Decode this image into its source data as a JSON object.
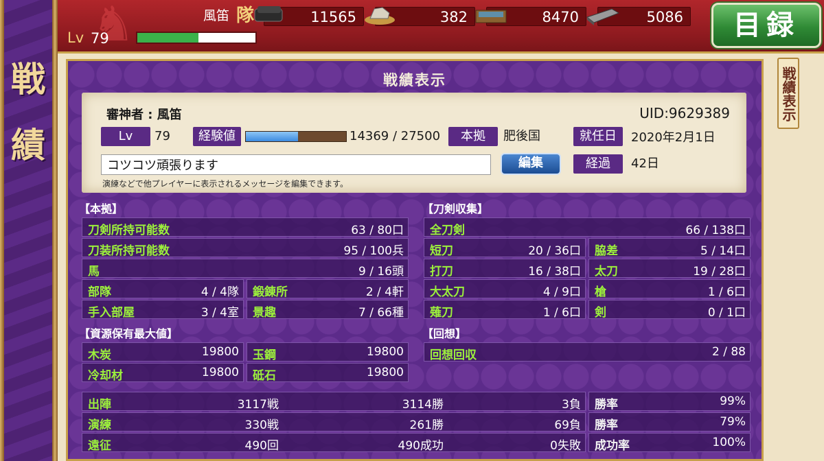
{
  "header": {
    "player_name": "風笛",
    "butai_label": "隊",
    "level_label": "Lv",
    "level_value": "79",
    "level_progress": 0.52,
    "resources": [
      {
        "icon": "charcoal-icon",
        "value": "11565"
      },
      {
        "icon": "tamahagane-icon",
        "value": "382"
      },
      {
        "icon": "coolant-icon",
        "value": "8470"
      },
      {
        "icon": "whetstone-icon",
        "value": "5086"
      }
    ],
    "menu_button": "目録"
  },
  "left_panel": {
    "title": "戦績"
  },
  "side_tab": {
    "label": "戦績表示"
  },
  "panel": {
    "title": "戦績表示",
    "profile": {
      "name": "審神者 : 風笛",
      "uid": "UID:9629389",
      "lv_label": "Lv",
      "lv_value": "79",
      "exp_label": "経験値",
      "exp_text": "14369 / 27500",
      "exp_progress": 0.5225,
      "home_label": "本拠",
      "home_value": "肥後国",
      "appoint_label": "就任日",
      "appoint_value": "2020年2月1日",
      "elapsed_label": "経過",
      "elapsed_value": "42日",
      "message": "コツコツ頑張ります",
      "edit_button": "編集",
      "hint": "演練などで他プレイヤーに表示されるメッセージを編集できます。"
    },
    "honkyo": {
      "head": "【本拠】",
      "rows": [
        {
          "label": "刀剣所持可能数",
          "value": "63 / 80口"
        },
        {
          "label": "刀装所持可能数",
          "value": "95 / 100兵"
        },
        {
          "label": "馬",
          "value": "9 / 16頭"
        }
      ],
      "pairs": [
        {
          "label": "部隊",
          "value": "4 / 4隊"
        },
        {
          "label": "鍛錬所",
          "value": "2 / 4軒"
        },
        {
          "label": "手入部屋",
          "value": "3 / 4室"
        },
        {
          "label": "景趣",
          "value": "7 / 66種"
        }
      ]
    },
    "resources_max": {
      "head": "【資源保有最大値】",
      "items": [
        {
          "label": "木炭",
          "value": "19800"
        },
        {
          "label": "玉鋼",
          "value": "19800"
        },
        {
          "label": "冷却材",
          "value": "19800"
        },
        {
          "label": "砥石",
          "value": "19800"
        }
      ]
    },
    "touken": {
      "head": "【刀剣収集】",
      "all": {
        "label": "全刀剣",
        "value": "66 / 138口"
      },
      "items": [
        {
          "label": "短刀",
          "value": "20 / 36口"
        },
        {
          "label": "脇差",
          "value": "5 / 14口"
        },
        {
          "label": "打刀",
          "value": "16 / 38口"
        },
        {
          "label": "太刀",
          "value": "19 / 28口"
        },
        {
          "label": "大太刀",
          "value": "4 / 9口"
        },
        {
          "label": "槍",
          "value": "1 / 6口"
        },
        {
          "label": "薙刀",
          "value": "1 / 6口"
        },
        {
          "label": "剣",
          "value": "0 / 1口"
        }
      ]
    },
    "kaisou": {
      "head": "【回想】",
      "row": {
        "label": "回想回収",
        "value": "2 / 88"
      }
    },
    "battle": [
      {
        "label": "出陣",
        "c1": "3117戦",
        "c2": "3114勝",
        "c3": "3負",
        "rate_label": "勝率",
        "rate": "99%"
      },
      {
        "label": "演練",
        "c1": "330戦",
        "c2": "261勝",
        "c3": "69負",
        "rate_label": "勝率",
        "rate": "79%"
      },
      {
        "label": "遠征",
        "c1": "490回",
        "c2": "490成功",
        "c3": "0失敗",
        "rate_label": "成功率",
        "rate": "100%"
      }
    ]
  }
}
